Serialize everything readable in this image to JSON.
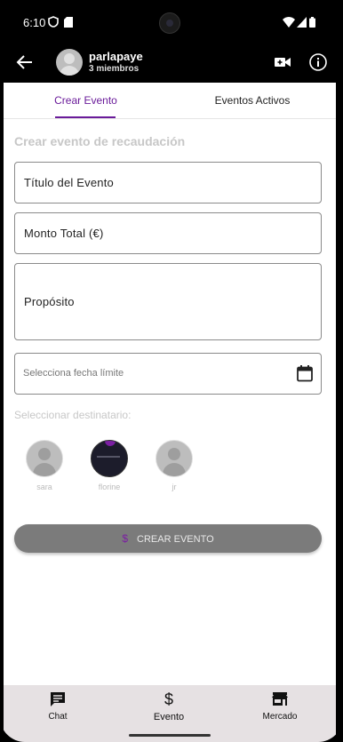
{
  "status_bar": {
    "time": "6:10"
  },
  "app_bar": {
    "group_name": "parlapaye",
    "members": "3 miembros"
  },
  "tabs": [
    {
      "label": "Crear Evento",
      "active": true
    },
    {
      "label": "Eventos Activos",
      "active": false
    }
  ],
  "form": {
    "section_title": "Crear evento de recaudación",
    "title_label": "Título del Evento",
    "amount_label": "Monto Total (€)",
    "purpose_label": "Propósito",
    "date_placeholder": "Selecciona fecha límite",
    "recipient_title": "Seleccionar destinatario:",
    "recipients": [
      {
        "name": "sara"
      },
      {
        "name": "florine"
      },
      {
        "name": "jr"
      }
    ],
    "submit_icon": "$",
    "submit_label": "CREAR EVENTO"
  },
  "bottom_nav": [
    {
      "label": "Chat",
      "icon": "chat-icon"
    },
    {
      "label": "Evento",
      "icon": "dollar-icon"
    },
    {
      "label": "Mercado",
      "icon": "store-icon"
    }
  ],
  "colors": {
    "accent": "#6a1b9a",
    "button_bg": "#7b7b7b",
    "nav_bg": "#e6e1e3"
  }
}
